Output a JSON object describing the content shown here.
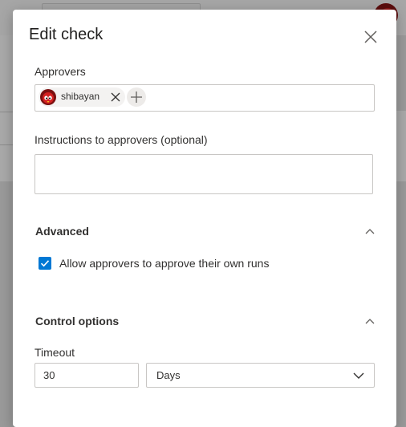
{
  "dialog": {
    "title": "Edit check",
    "approvers_label": "Approvers",
    "approvers": [
      {
        "name": "shibayan"
      }
    ],
    "instructions_label": "Instructions to approvers (optional)",
    "instructions_value": "",
    "advanced": {
      "heading": "Advanced",
      "expanded": true,
      "allow_self_approve_label": "Allow approvers to approve their own runs",
      "allow_self_approve_checked": true
    },
    "control_options": {
      "heading": "Control options",
      "expanded": true,
      "timeout_label": "Timeout",
      "timeout_value": "30",
      "timeout_unit": "Days"
    }
  },
  "colors": {
    "accent": "#0078d4",
    "border": "#c8c6c4",
    "text": "#323130",
    "overlay": "#9a9a9a"
  },
  "icons": [
    "close-icon",
    "remove-icon",
    "add-icon",
    "chevron-up-icon",
    "chevron-down-icon",
    "checkmark-icon"
  ]
}
